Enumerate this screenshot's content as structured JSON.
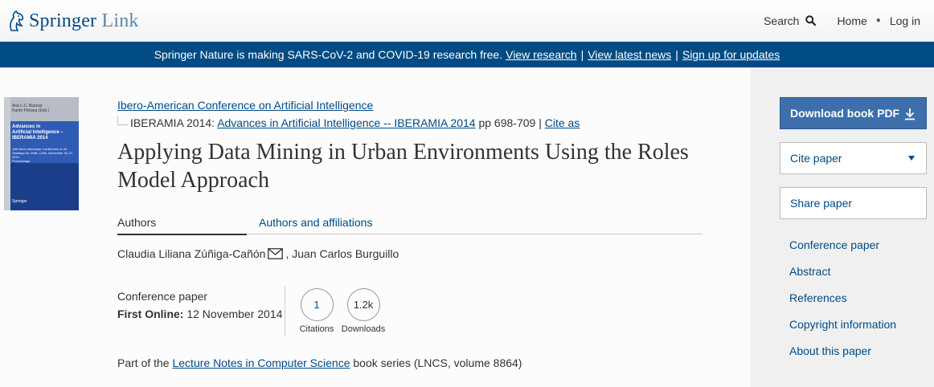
{
  "header": {
    "logo_main": "Springer",
    "logo_light": " Link",
    "search_label": "Search",
    "home_label": "Home",
    "login_label": "Log in"
  },
  "banner": {
    "message": "Springer Nature is making SARS-CoV-2 and COVID-19 research free.",
    "link1": "View research",
    "link2": "View latest news",
    "link3": "Sign up for updates",
    "separator": "|"
  },
  "cover": {
    "editors": "Ana L.C. Bazzan\nKarim Pichara (Eds.)",
    "title": "Advances in\nArtificial Intelligence –\nIBERAMIA 2014",
    "subtitle": "14th Ibero-American Conference on AI\nSantiago de Chile, Chile, November 24-27, 2014\nProceedings",
    "publisher": "Springer"
  },
  "paper": {
    "conference_link": "Ibero-American Conference on Artificial Intelligence",
    "proceedings_prefix": "IBERAMIA 2014:",
    "proceedings_link": "Advances in Artificial Intelligence -- IBERAMIA 2014",
    "pages": "pp 698-709",
    "pipe": "|",
    "cite_as": "Cite as",
    "title": "Applying Data Mining in Urban Environments Using the Roles Model Approach"
  },
  "tabs": {
    "authors": "Authors",
    "affiliations": "Authors and affiliations"
  },
  "authors": {
    "first": "Claudia Liliana Zúñiga-Cañón",
    "rest": ", Juan Carlos Burguillo"
  },
  "meta": {
    "type": "Conference paper",
    "first_online_label": "First Online:",
    "first_online_date": "12 November 2014"
  },
  "metrics": {
    "citations_value": "1",
    "citations_label": "Citations",
    "downloads_value": "1.2k",
    "downloads_label": "Downloads"
  },
  "series": {
    "prefix": "Part of the",
    "link": "Lecture Notes in Computer Science",
    "suffix": "book series (LNCS, volume 8864)"
  },
  "sidebar": {
    "download_label": "Download book PDF",
    "cite_label": "Cite paper",
    "share_label": "Share paper",
    "links": [
      "Conference paper",
      "Abstract",
      "References",
      "Copyright information",
      "About this paper"
    ]
  },
  "colors": {
    "brand": "#004b83",
    "download_button": "#3d70aa",
    "sidebar_bg": "#f0f0f0"
  }
}
